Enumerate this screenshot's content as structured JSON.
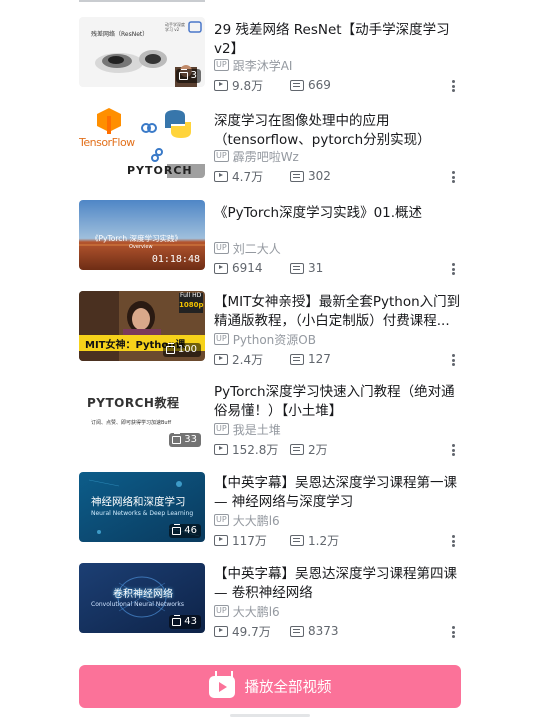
{
  "playlist": {
    "items": [
      {
        "title": "29 残差网络 ResNet【动手学深度学习v2】",
        "uploader": "跟李沐学AI",
        "views": "9.8万",
        "danmaku": "669",
        "badge": "3",
        "thumb_text": [
          "残差网络（ResNet）",
          "动手学深度学习 v2"
        ]
      },
      {
        "title": "深度学习在图像处理中的应用（tensorflow、pytorch分别实现）",
        "uploader": "霹雳吧啦Wz",
        "views": "4.7万",
        "danmaku": "302",
        "badge": "",
        "thumb_text": [
          "TensorFlow",
          "PYTORCH"
        ]
      },
      {
        "title": "《PyTorch深度学习实践》01.概述",
        "uploader": "刘二大人",
        "views": "6914",
        "danmaku": "31",
        "badge": "01:18:48",
        "thumb_text": [
          "《PyTorch 深度学习实践》",
          "Overview"
        ]
      },
      {
        "title": "【MIT女神亲授】最新全套Python入门到精通版教程，（小白定制版）付费课程...",
        "uploader": "Python资源OB",
        "views": "2.4万",
        "danmaku": "127",
        "badge": "100",
        "thumb_text": [
          "MIT女神：Python课",
          "Full HD",
          "1080p"
        ]
      },
      {
        "title": "PyTorch深度学习快速入门教程（绝对通俗易懂！）【小土堆】",
        "uploader": "我是土堆",
        "views": "152.8万",
        "danmaku": "2万",
        "badge": "33",
        "thumb_text": [
          "PYTORCH教程",
          "订阅、点赞、即可获得学习加速Buff"
        ]
      },
      {
        "title": "【中英字幕】吴恩达深度学习课程第一课 — 神经网络与深度学习",
        "uploader": "大大鹏l6",
        "views": "117万",
        "danmaku": "1.2万",
        "badge": "46",
        "thumb_text": [
          "神经网络和深度学习",
          "Neural Networks & Deep Learning"
        ]
      },
      {
        "title": "【中英字幕】吴恩达深度学习课程第四课 — 卷积神经网络",
        "uploader": "大大鹏l6",
        "views": "49.7万",
        "danmaku": "8373",
        "badge": "43",
        "thumb_text": [
          "卷积神经网络",
          "Convolutional Neural Networks"
        ]
      }
    ],
    "up_tag": "UP"
  },
  "footer": {
    "play_all_label": "播放全部视频"
  },
  "colors": {
    "accent": "#fb7299",
    "text_primary": "#18191c",
    "text_secondary": "#9499a0"
  }
}
